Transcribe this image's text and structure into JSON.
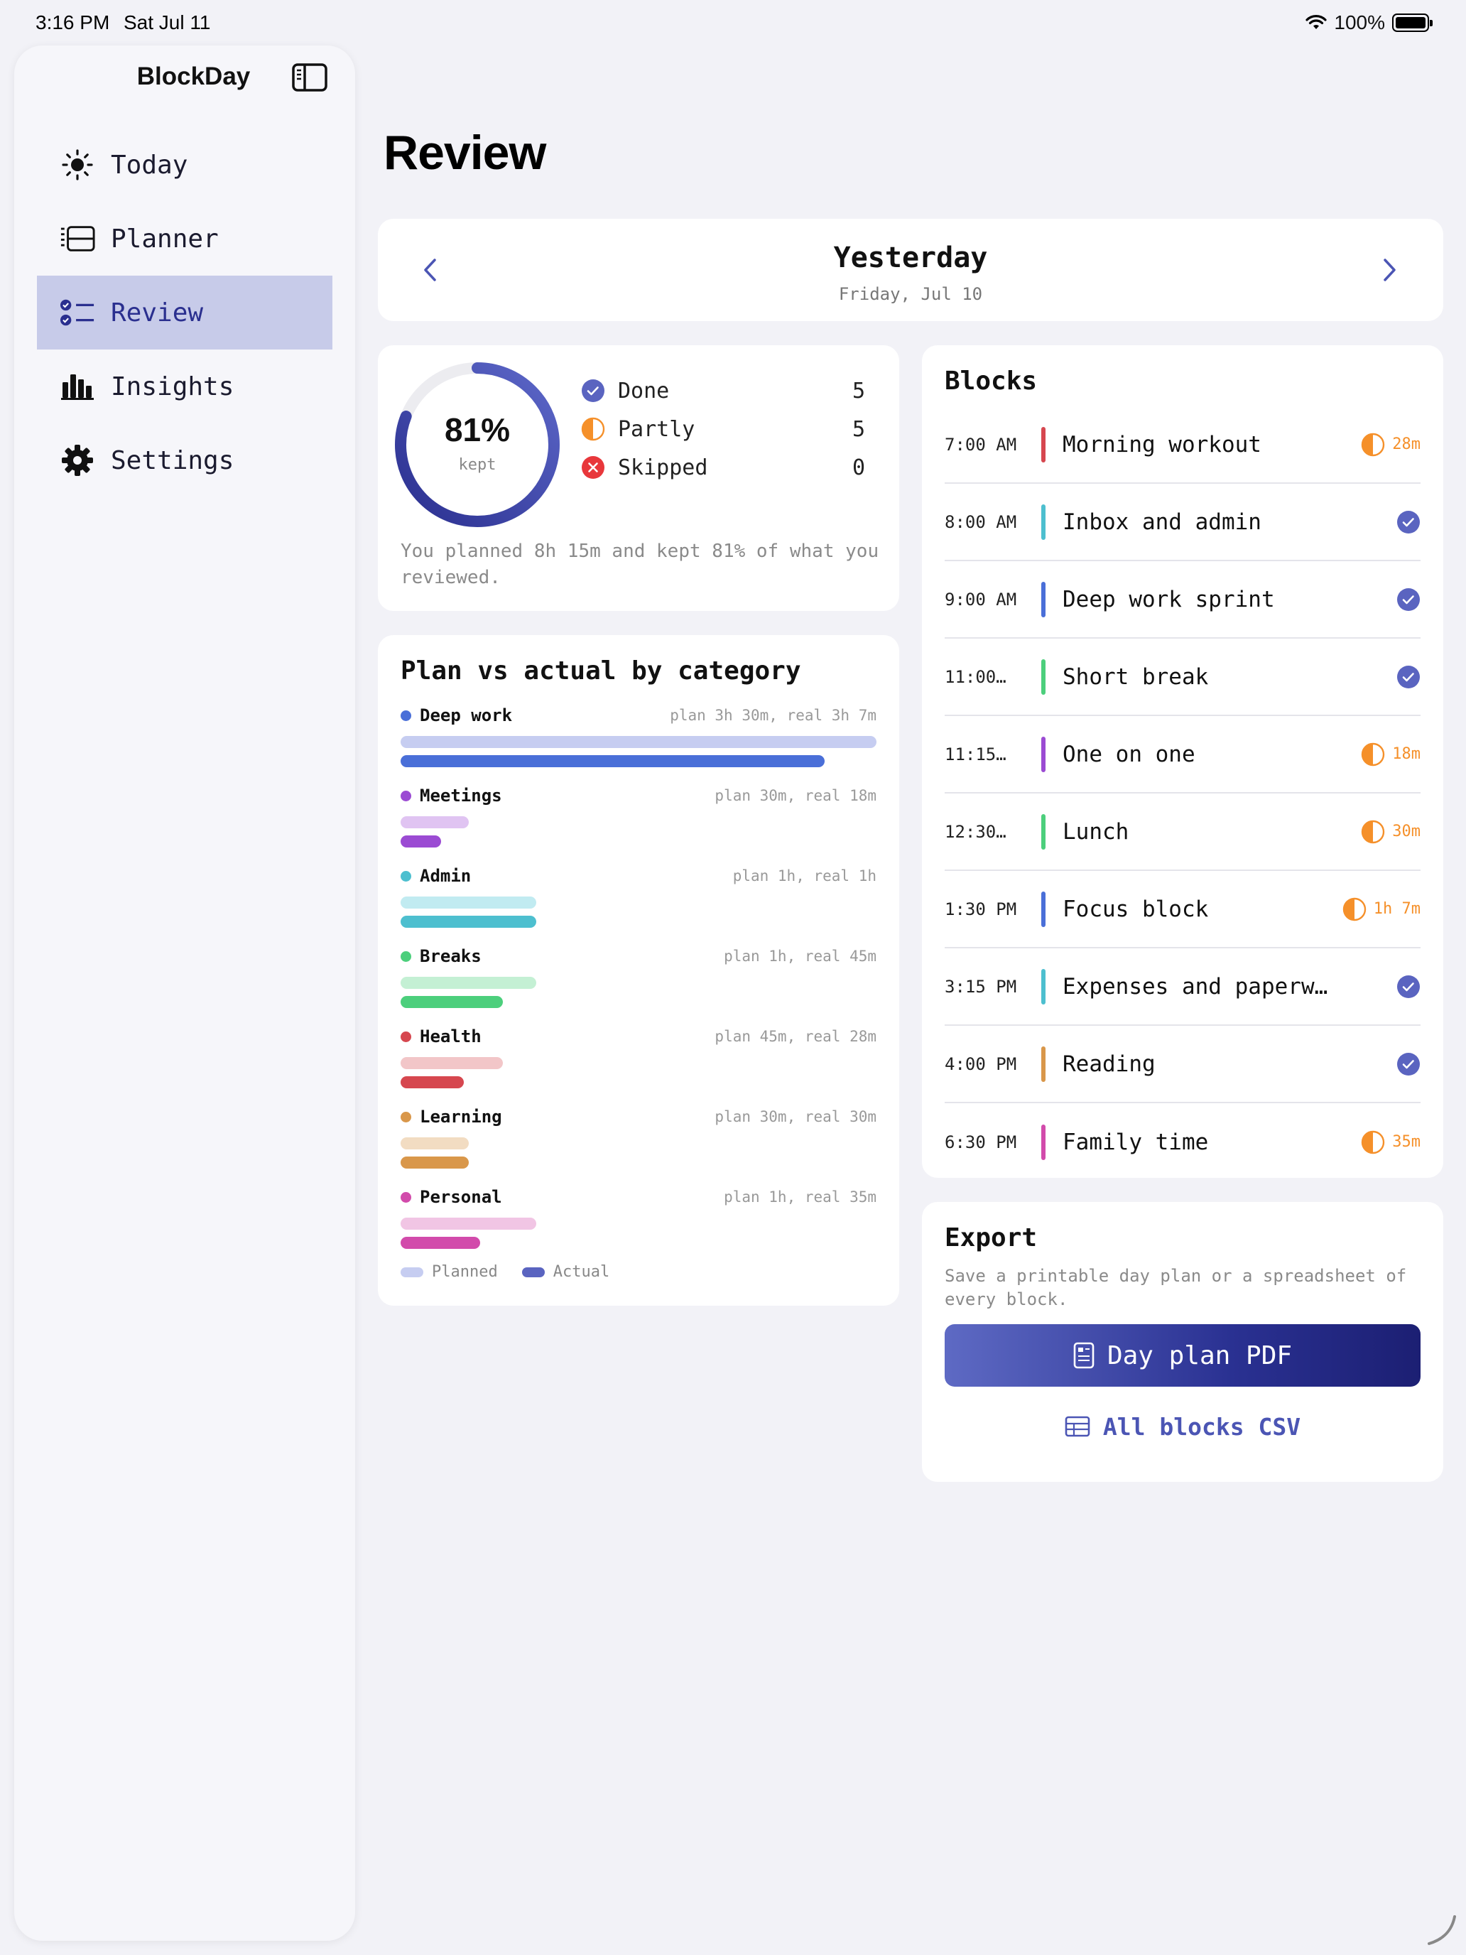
{
  "status_bar": {
    "time": "3:16 PM",
    "date": "Sat Jul 11",
    "battery": "100%"
  },
  "sidebar": {
    "app_title": "BlockDay",
    "items": [
      {
        "label": "Today",
        "icon": "sun-icon",
        "active": false
      },
      {
        "label": "Planner",
        "icon": "planner-icon",
        "active": false
      },
      {
        "label": "Review",
        "icon": "checklist-icon",
        "active": true
      },
      {
        "label": "Insights",
        "icon": "bar-chart-icon",
        "active": false
      },
      {
        "label": "Settings",
        "icon": "gear-icon",
        "active": false
      }
    ]
  },
  "page": {
    "title": "Review"
  },
  "date_nav": {
    "title": "Yesterday",
    "subtitle": "Friday, Jul 10"
  },
  "summary": {
    "percent": "81%",
    "percent_value": 0.81,
    "percent_label": "kept",
    "legend": [
      {
        "label": "Done",
        "value": "5",
        "icon": "check-circle-icon",
        "color": "#5a64c0"
      },
      {
        "label": "Partly",
        "value": "5",
        "icon": "half-circle-icon",
        "color": "#f5902a"
      },
      {
        "label": "Skipped",
        "value": "0",
        "icon": "x-circle-icon",
        "color": "#e8373b"
      }
    ],
    "text": "You planned 8h 15m and kept 81% of what you reviewed."
  },
  "categories": {
    "title": "Plan vs actual by category",
    "items": [
      {
        "name": "Deep work",
        "meta": "plan 3h 30m, real 3h 7m",
        "color": "#4a6fd8",
        "planned_color": "#c6cdf1",
        "planned_min": 210,
        "actual_min": 187
      },
      {
        "name": "Meetings",
        "meta": "plan 30m, real 18m",
        "color": "#9b4bd3",
        "planned_color": "#e0c4f2",
        "planned_min": 30,
        "actual_min": 18
      },
      {
        "name": "Admin",
        "meta": "plan 1h, real 1h",
        "color": "#4dbfcf",
        "planned_color": "#c1ebf1",
        "planned_min": 60,
        "actual_min": 60
      },
      {
        "name": "Breaks",
        "meta": "plan 1h, real 45m",
        "color": "#4ccf7c",
        "planned_color": "#c4f0d4",
        "planned_min": 60,
        "actual_min": 45
      },
      {
        "name": "Health",
        "meta": "plan 45m, real 28m",
        "color": "#d6474f",
        "planned_color": "#f2c6c8",
        "planned_min": 45,
        "actual_min": 28
      },
      {
        "name": "Learning",
        "meta": "plan 30m, real 30m",
        "color": "#d9974a",
        "planned_color": "#f2dcc2",
        "planned_min": 30,
        "actual_min": 30
      },
      {
        "name": "Personal",
        "meta": "plan 1h, real 35m",
        "color": "#d24bab",
        "planned_color": "#f1c5e4",
        "planned_min": 60,
        "actual_min": 35
      }
    ],
    "legend_planned": "Planned",
    "legend_actual": "Actual",
    "legend_planned_color": "#c6cdf1",
    "legend_actual_color": "#5a64c0"
  },
  "blocks": {
    "title": "Blocks",
    "items": [
      {
        "time": "7:00 AM",
        "name": "Morning workout",
        "color": "#d6474f",
        "status": "partly",
        "duration": "28m"
      },
      {
        "time": "8:00 AM",
        "name": "Inbox and admin",
        "color": "#4dbfcf",
        "status": "done",
        "duration": ""
      },
      {
        "time": "9:00 AM",
        "name": "Deep work sprint",
        "color": "#4a6fd8",
        "status": "done",
        "duration": ""
      },
      {
        "time": "11:00…",
        "name": "Short break",
        "color": "#4ccf7c",
        "status": "done",
        "duration": ""
      },
      {
        "time": "11:15…",
        "name": "One on one",
        "color": "#9b4bd3",
        "status": "partly",
        "duration": "18m"
      },
      {
        "time": "12:30…",
        "name": "Lunch",
        "color": "#4ccf7c",
        "status": "partly",
        "duration": "30m"
      },
      {
        "time": "1:30 PM",
        "name": "Focus block",
        "color": "#4a6fd8",
        "status": "partly",
        "duration": "1h 7m"
      },
      {
        "time": "3:15 PM",
        "name": "Expenses and paperw…",
        "color": "#4dbfcf",
        "status": "done",
        "duration": ""
      },
      {
        "time": "4:00 PM",
        "name": "Reading",
        "color": "#d9974a",
        "status": "done",
        "duration": ""
      },
      {
        "time": "6:30 PM",
        "name": "Family time",
        "color": "#d24bab",
        "status": "partly",
        "duration": "35m"
      }
    ]
  },
  "export": {
    "title": "Export",
    "description": "Save a printable day plan or a spreadsheet of every block.",
    "pdf_label": "Day plan PDF",
    "csv_label": "All blocks CSV"
  },
  "colors": {
    "accent": "#4b55b4",
    "active_nav": "#c7cbe9",
    "partly": "#f5902a",
    "done": "#5a64c0",
    "skipped": "#e8373b"
  }
}
